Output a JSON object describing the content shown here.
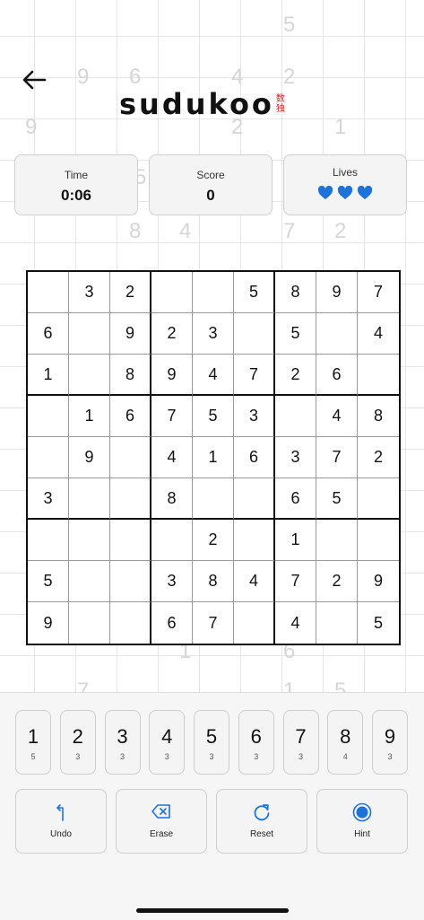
{
  "header": {
    "logo_text": "sudukoo",
    "logo_kanji_1": "数",
    "logo_kanji_2": "独"
  },
  "stats": {
    "time_label": "Time",
    "time_value": "0:06",
    "score_label": "Score",
    "score_value": "0",
    "lives_label": "Lives",
    "lives_count": 3,
    "heart_color": "#1e73d8"
  },
  "background_digits": [
    "5",
    "9",
    "6",
    "4",
    "2",
    "9",
    "2",
    "1",
    "5",
    "8",
    "4",
    "7",
    "2",
    "6",
    "1",
    "7",
    "1",
    "5"
  ],
  "board": [
    [
      "",
      "3",
      "2",
      "",
      "",
      "5",
      "8",
      "9",
      "7"
    ],
    [
      "6",
      "",
      "9",
      "2",
      "3",
      "",
      "5",
      "",
      "4"
    ],
    [
      "1",
      "",
      "8",
      "9",
      "4",
      "7",
      "2",
      "6",
      ""
    ],
    [
      "",
      "1",
      "6",
      "7",
      "5",
      "3",
      "",
      "4",
      "8"
    ],
    [
      "",
      "9",
      "",
      "4",
      "1",
      "6",
      "3",
      "7",
      "2"
    ],
    [
      "3",
      "",
      "",
      "8",
      "",
      "",
      "6",
      "5",
      ""
    ],
    [
      "",
      "",
      "",
      "",
      "2",
      "",
      "1",
      "",
      ""
    ],
    [
      "5",
      "",
      "",
      "3",
      "8",
      "4",
      "7",
      "2",
      "9"
    ],
    [
      "9",
      "",
      "",
      "6",
      "7",
      "",
      "4",
      "",
      "5"
    ]
  ],
  "number_pad": [
    {
      "num": "1",
      "count": "5"
    },
    {
      "num": "2",
      "count": "3"
    },
    {
      "num": "3",
      "count": "3"
    },
    {
      "num": "4",
      "count": "3"
    },
    {
      "num": "5",
      "count": "3"
    },
    {
      "num": "6",
      "count": "3"
    },
    {
      "num": "7",
      "count": "3"
    },
    {
      "num": "8",
      "count": "4"
    },
    {
      "num": "9",
      "count": "3"
    }
  ],
  "actions": {
    "undo": "Undo",
    "erase": "Erase",
    "reset": "Reset",
    "hint": "Hint"
  },
  "colors": {
    "accent": "#1e73d8",
    "logo_kanji": "#c62828"
  }
}
